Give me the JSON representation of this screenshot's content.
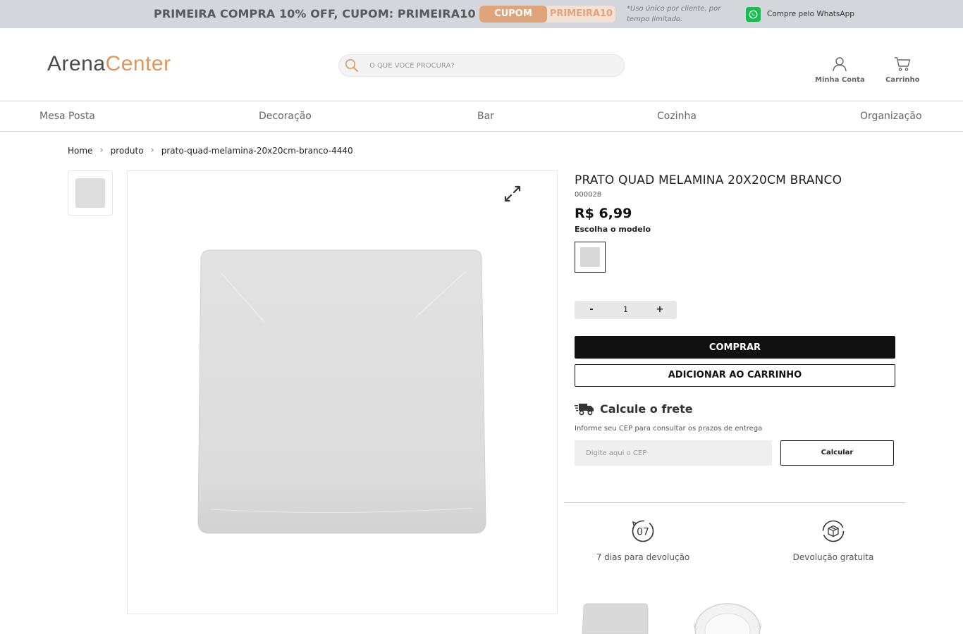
{
  "promo": {
    "headline": "PRIMEIRA COMPRA 10% OFF, CUPOM: PRIMEIRA10",
    "coupon_label": "CUPOM",
    "coupon_code": "PRIMEIRA10",
    "note": "*Uso único por cliente, por tempo limitado.",
    "whatsapp": "Compre pelo WhatsApp"
  },
  "header": {
    "logo_part1": "Arena",
    "logo_part2": "Center",
    "search_placeholder": "O QUE VOCÊ PROCURA?",
    "account_label": "Minha Conta",
    "cart_label": "Carrinho"
  },
  "nav": [
    "Mesa Posta",
    "Decoração",
    "Bar",
    "Cozinha",
    "Organização"
  ],
  "breadcrumb": [
    "Home",
    "produto",
    "prato-quad-melamina-20x20cm-branco-4440"
  ],
  "product": {
    "title": "PRATO QUAD MELAMINA 20X20CM BRANCO",
    "sku": "000028",
    "price": "R$ 6,99",
    "model_label": "Escolha o modelo",
    "quantity": "1",
    "qty_minus": "-",
    "qty_plus": "+",
    "buy_label": "COMPRAR",
    "add_to_cart_label": "ADICIONAR AO CARRINHO"
  },
  "shipping": {
    "title": "Calcule o frete",
    "info": "Informe seu CEP para consultar os prazos de entrega",
    "cep_placeholder": "Digite aqui o CEP",
    "calc_label": "Calcular"
  },
  "features": [
    {
      "icon": "seven-days-icon",
      "badge": "07",
      "label": "7 dias para devolução"
    },
    {
      "icon": "free-return-box-icon",
      "label": "Devolução gratuita"
    }
  ],
  "colors": {
    "promo_bg": "#d3d6db",
    "accent": "#e0a47c",
    "whatsapp": "#1fb954",
    "dark": "#111111"
  }
}
